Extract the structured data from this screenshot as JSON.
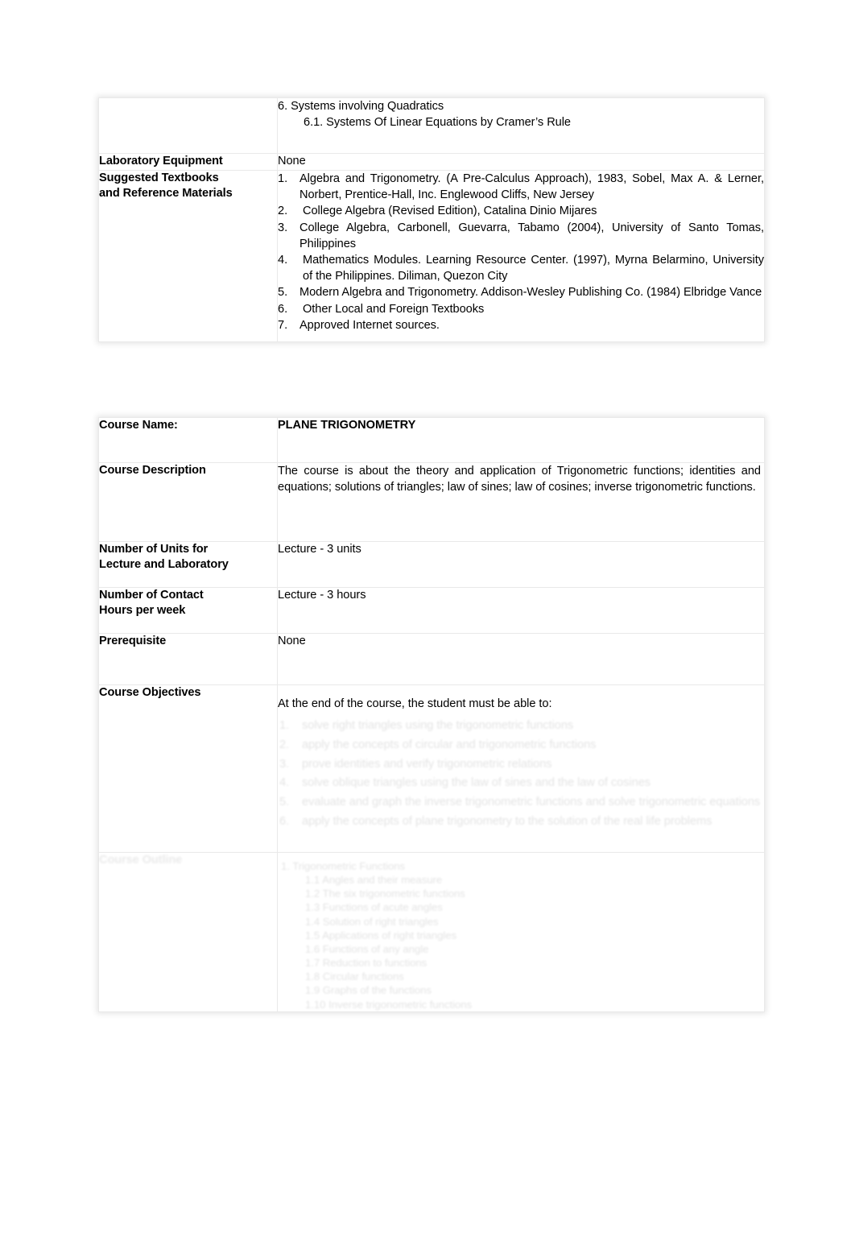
{
  "document": {
    "type": "course-syllabus-table",
    "page_background": "#ffffff",
    "table_border_color": "#e9e9e9"
  },
  "table_outline": {
    "rows": [
      {
        "label": "",
        "kind": "topic-outline",
        "lines": [
          {
            "text": "6.  Systems  involving  Quadratics",
            "level": 1
          },
          {
            "text": "6.1. Systems Of Linear Equations by Cramer’s Rule",
            "level": 2
          }
        ]
      },
      {
        "label": "Laboratory Equipment",
        "kind": "plain",
        "value": "None"
      },
      {
        "label": "Suggested Textbooks and Reference Materials",
        "label_line1": "Suggested Textbooks",
        "label_line2": "and Reference Materials",
        "kind": "ordered-list",
        "items": [
          {
            "num": "1.",
            "text": "Algebra and Trigonometry. (A Pre-Calculus Approach), 1983, Sobel, Max A. & Lerner, Norbert, Prentice-Hall, Inc. Englewood Cliffs, New Jersey"
          },
          {
            "num": "2.",
            "text": "College Algebra (Revised Edition), Catalina Dinio Mijares"
          },
          {
            "num": "3.",
            "text": "College Algebra, Carbonell, Guevarra, Tabamo (2004), University of Santo Tomas, Philippines"
          },
          {
            "num": "4.",
            "text": "Mathematics Modules. Learning Resource Center. (1997), Myrna Belarmino, University of the Philippines. Diliman, Quezon City"
          },
          {
            "num": "5.",
            "text": "Modern Algebra and Trigonometry. Addison-Wesley Publishing Co. (1984) Elbridge Vance"
          },
          {
            "num": "6.",
            "text": "Other Local and Foreign Textbooks"
          },
          {
            "num": "7.",
            "text": "Approved  Internet  sources."
          }
        ]
      }
    ]
  },
  "table_course": {
    "rows": [
      {
        "label": "Course Name:",
        "kind": "bold-value",
        "value": "PLANE TRIGONOMETRY"
      },
      {
        "label": "Course Description",
        "kind": "paragraph",
        "value": "The course is about the theory and application of Trigonometric functions; identities and equations; solutions of triangles; law of sines; law of cosines; inverse trigonometric functions."
      },
      {
        "label": "Number of Units for Lecture and Laboratory",
        "label_line1": "Number of Units for",
        "label_line2": "Lecture and Laboratory",
        "kind": "plain",
        "value": "Lecture - 3 units"
      },
      {
        "label": "Number of Contact Hours per week",
        "label_line1": "Number of Contact",
        "label_line2": "Hours per week",
        "kind": "plain",
        "value": "Lecture - 3 hours"
      },
      {
        "label": "Prerequisite",
        "kind": "plain",
        "value": "None"
      },
      {
        "label": "Course Objectives",
        "kind": "objectives",
        "intro": "At the end of the course, the student must be able to:",
        "faded_note": "remaining objective list is faded/illegible in the source image",
        "faded_items": [
          {
            "num": "1.",
            "text": ""
          },
          {
            "num": "2.",
            "text": ""
          },
          {
            "num": "3.",
            "text": ""
          },
          {
            "num": "4.",
            "text": ""
          },
          {
            "num": "5.",
            "text": ""
          },
          {
            "num": "6.",
            "text": ""
          }
        ]
      },
      {
        "label": "",
        "label_faded": true,
        "kind": "faded-outline",
        "faded_note": "course outline content is faded/illegible in the source image",
        "faded_lines": [
          "",
          "",
          "",
          "",
          "",
          "",
          "",
          "",
          "",
          "",
          ""
        ]
      }
    ]
  }
}
